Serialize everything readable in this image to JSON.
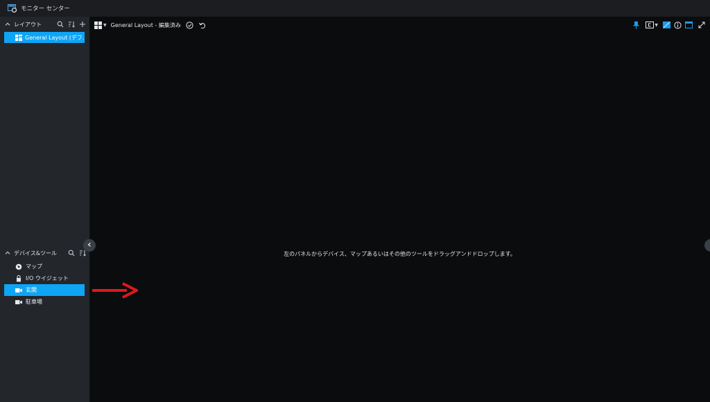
{
  "window": {
    "title": "モニター センター"
  },
  "layout_panel": {
    "title": "レイアウト",
    "items": [
      {
        "label": "General Layout (デフ..."
      }
    ]
  },
  "devices_panel": {
    "title": "デバイス&ツール",
    "items": [
      {
        "label": "マップ",
        "icon": "map-icon"
      },
      {
        "label": "I/O ウイジェット",
        "icon": "io-widget-icon"
      },
      {
        "label": "玄関",
        "icon": "camera-icon",
        "selected": true
      },
      {
        "label": "駐車場",
        "icon": "camera-icon"
      }
    ]
  },
  "toolbar": {
    "layout_title": "General Layout - 編集済み"
  },
  "main": {
    "hint": "左のパネルからデバイス、マップあるいはその他のツールをドラッグアンドドロップします。"
  },
  "colors": {
    "accent": "#0ea5f5",
    "arrow": "#e01818",
    "background": "#0b0c0e",
    "sidebar": "#23262b"
  }
}
